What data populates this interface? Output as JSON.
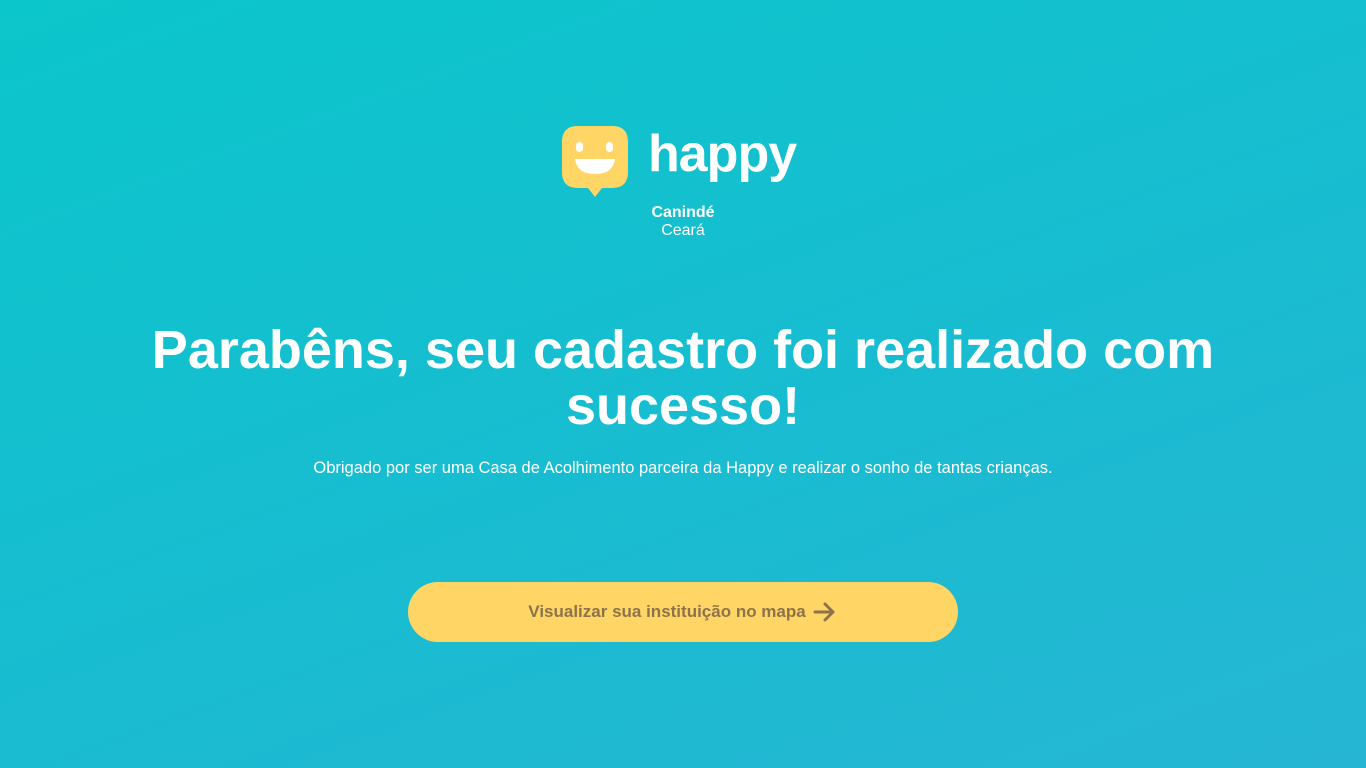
{
  "brand": {
    "name": "happy",
    "city": "Canindé",
    "state": "Ceará",
    "icon": "smiley-chat-icon"
  },
  "main": {
    "title": "Parabêns, seu cadastro foi realizado com sucesso!",
    "subtitle": "Obrigado por ser uma Casa de Acolhimento parceira da Happy e realizar o sonho de tantas crianças."
  },
  "cta": {
    "label": "Visualizar sua instituição no mapa",
    "icon": "arrow-right-icon"
  },
  "colors": {
    "background_start": "#0bc6cb",
    "background_end": "#26b6d4",
    "logo_yellow": "#ffd666",
    "button_bg": "#ffd666",
    "button_text": "#8d734b",
    "text": "#ffffff"
  }
}
